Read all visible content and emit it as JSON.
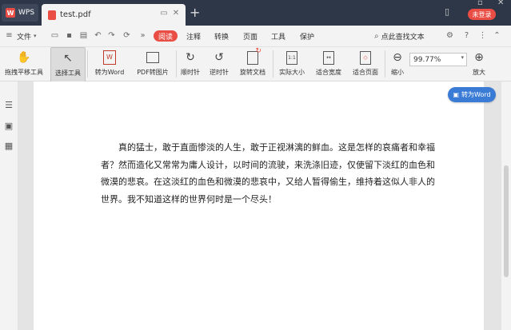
{
  "titlebar": {
    "app_tab": "WPS",
    "doc_tab": "test.pdf",
    "login_label": "未登录"
  },
  "menubar": {
    "file_label": "文件",
    "read_label": "阅读",
    "items": [
      "注释",
      "转换",
      "页面",
      "工具",
      "保护"
    ],
    "search_label": "点此查找文本"
  },
  "ribbon": {
    "tools": [
      {
        "label": "拖拽平移工具",
        "icon": "hand-icon"
      },
      {
        "label": "选择工具",
        "icon": "cursor-icon"
      },
      {
        "label": "转为Word",
        "icon": "word-convert-icon"
      },
      {
        "label": "PDF转图片",
        "icon": "image-convert-icon"
      },
      {
        "label": "顺时针",
        "icon": "rotate-cw-icon"
      },
      {
        "label": "逆时针",
        "icon": "rotate-ccw-icon"
      },
      {
        "label": "旋转文档",
        "icon": "rotate-doc-icon"
      },
      {
        "label": "实际大小",
        "icon": "actual-size-icon"
      },
      {
        "label": "适合宽度",
        "icon": "fit-width-icon"
      },
      {
        "label": "适合页面",
        "icon": "fit-page-icon"
      },
      {
        "label": "缩小",
        "icon": "zoom-out-icon"
      },
      {
        "label": "放大",
        "icon": "zoom-in-icon"
      }
    ],
    "zoom_value": "99.77%"
  },
  "float_button": {
    "label": "转为Word"
  },
  "document": {
    "paragraph": "真的猛士，敢于直面惨淡的人生，敢于正视淋漓的鲜血。这是怎样的哀痛者和幸福者？然而造化又常常为庸人设计，以时间的流驶，来洗涤旧迹，仅使留下淡红的血色和微漠的悲哀。在这淡红的血色和微漠的悲哀中，又给人暂得偷生，维持着这似人非人的世界。我不知道这样的世界何时是一个尽头！"
  },
  "colors": {
    "titlebar_bg": "#2e3747",
    "accent_red": "#e94d43",
    "accent_blue": "#3a7bd5"
  }
}
